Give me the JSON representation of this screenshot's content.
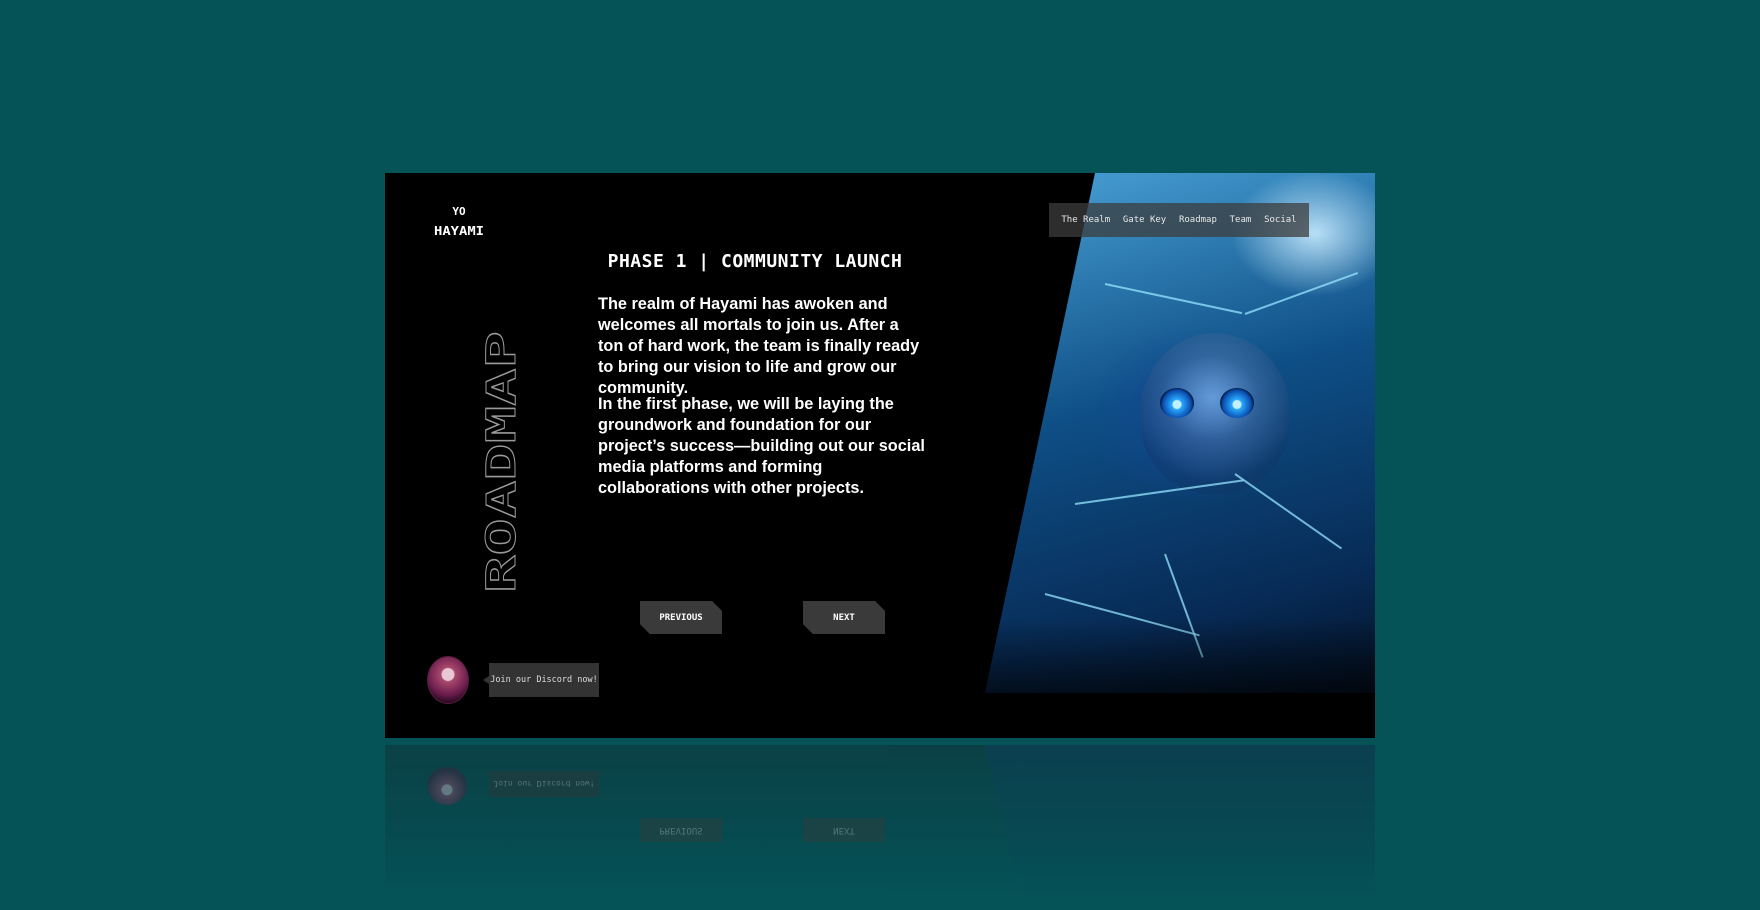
{
  "brand": {
    "logo_text": "HAYAMI",
    "logo_top": "YO"
  },
  "nav": {
    "items": [
      "The Realm",
      "Gate Key",
      "Roadmap",
      "Team",
      "Social"
    ]
  },
  "section": {
    "vertical_title": "ROADMAP"
  },
  "phase": {
    "heading": "PHASE 1 | COMMUNITY LAUNCH",
    "paragraph_1": "The realm of Hayami has awoken and welcomes all mortals to join us. After a ton of hard work, the team is finally ready to bring our vision to life and grow our community.",
    "paragraph_2": "In the first phase, we will be laying the groundwork and foundation for our project’s success—building out our social media platforms and forming collaborations with other projects."
  },
  "buttons": {
    "previous": "PREVIOUS",
    "next": "NEXT"
  },
  "discord": {
    "bubble_text": "Join our Discord now!"
  },
  "colors": {
    "page_bg": "#055257",
    "panel_bg": "#000000",
    "button_bg": "#3a3a3a",
    "nav_bg": "#3c3c3c",
    "accent_ice": "#29a9ff"
  }
}
